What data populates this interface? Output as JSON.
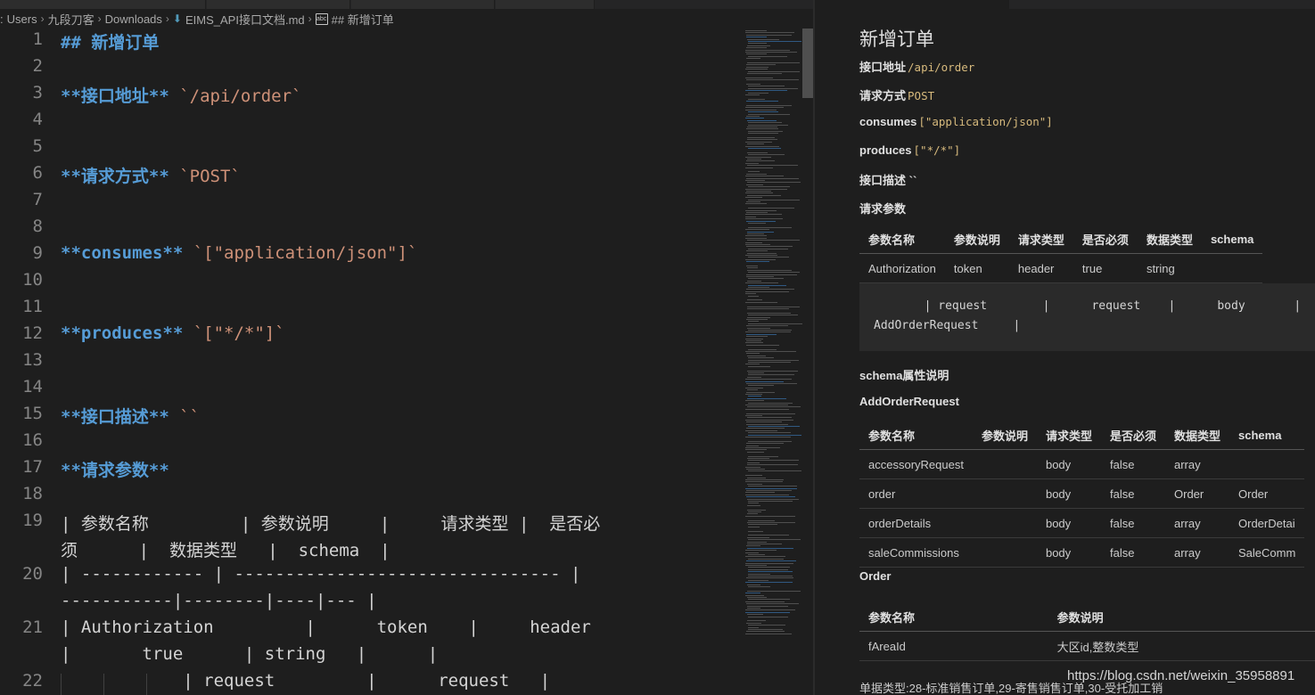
{
  "breadcrumb": {
    "items": [
      ":",
      "Users",
      "九段刀客",
      "Downloads",
      "EIMS_API接口文档.md",
      "## 新增订单"
    ],
    "download_icon": "download-file-icon",
    "symbol_icon": "abc-symbol-icon"
  },
  "editor": {
    "lines": [
      {
        "n": "1",
        "parts": [
          {
            "t": "## 新增订单",
            "c": "hdr"
          }
        ]
      },
      {
        "n": "2",
        "parts": []
      },
      {
        "n": "3",
        "parts": [
          {
            "t": "**接口地址**",
            "c": "bold"
          },
          {
            "t": " `/api/order`",
            "c": "str"
          }
        ]
      },
      {
        "n": "4",
        "parts": []
      },
      {
        "n": "5",
        "parts": []
      },
      {
        "n": "6",
        "parts": [
          {
            "t": "**请求方式**",
            "c": "bold"
          },
          {
            "t": " `POST`",
            "c": "str"
          }
        ]
      },
      {
        "n": "7",
        "parts": []
      },
      {
        "n": "8",
        "parts": []
      },
      {
        "n": "9",
        "parts": [
          {
            "t": "**consumes**",
            "c": "bold"
          },
          {
            "t": " `[\"application/json\"]`",
            "c": "str"
          }
        ]
      },
      {
        "n": "10",
        "parts": []
      },
      {
        "n": "11",
        "parts": []
      },
      {
        "n": "12",
        "parts": [
          {
            "t": "**produces**",
            "c": "bold"
          },
          {
            "t": " `[\"*/*\"]`",
            "c": "str"
          }
        ]
      },
      {
        "n": "13",
        "parts": []
      },
      {
        "n": "14",
        "parts": []
      },
      {
        "n": "15",
        "parts": [
          {
            "t": "**接口描述**",
            "c": "bold"
          },
          {
            "t": " ``",
            "c": "str"
          }
        ]
      },
      {
        "n": "16",
        "parts": []
      },
      {
        "n": "17",
        "parts": [
          {
            "t": "**请求参数**",
            "c": "bold"
          }
        ]
      },
      {
        "n": "18",
        "parts": []
      },
      {
        "n": "19",
        "parts": [
          {
            "t": "| 参数名称         | 参数说明     |     请求类型 |  是否必",
            "c": "plain"
          }
        ]
      },
      {
        "n": "",
        "parts": [
          {
            "t": "须      |  数据类型   |  schema  |",
            "c": "plain"
          }
        ]
      },
      {
        "n": "20",
        "parts": [
          {
            "t": "| ------------ | -------------------------------- |",
            "c": "plain"
          }
        ]
      },
      {
        "n": "",
        "parts": [
          {
            "t": "-----------|--------|----|--- |",
            "c": "plain"
          }
        ]
      },
      {
        "n": "21",
        "parts": [
          {
            "t": "| Authorization         |      token    |     header",
            "c": "plain"
          }
        ]
      },
      {
        "n": "",
        "parts": [
          {
            "t": "|       true      | string   |      |",
            "c": "plain"
          }
        ]
      },
      {
        "n": "22",
        "parts": [
          {
            "t": "            | request         |      request   |",
            "c": "plain"
          }
        ]
      }
    ]
  },
  "preview": {
    "title": "新增订单",
    "api_address_label": "接口地址",
    "api_address_value": "/api/order",
    "method_label": "请求方式",
    "method_value": "POST",
    "consumes_label": "consumes",
    "consumes_value": "[\"application/json\"]",
    "produces_label": "produces",
    "produces_value": "[\"*/*\"]",
    "description_label": "接口描述 ``",
    "request_params_label": "请求参数",
    "params_table": {
      "headers": [
        "参数名称",
        "参数说明",
        "请求类型",
        "是否必须",
        "数据类型",
        "schema"
      ],
      "rows": [
        [
          "Authorization",
          "token",
          "header",
          "true",
          "string",
          ""
        ]
      ]
    },
    "code_block": {
      "line1": "        | request        |      request    |      body       |",
      "line2": "AddOrderRequest     |"
    },
    "schema_desc_label": "schema属性说明",
    "schema_name": "AddOrderRequest",
    "schema_table": {
      "headers": [
        "参数名称",
        "参数说明",
        "请求类型",
        "是否必须",
        "数据类型",
        "schema"
      ],
      "rows": [
        [
          "accessoryRequest",
          "",
          "body",
          "false",
          "array",
          ""
        ],
        [
          "order",
          "",
          "body",
          "false",
          "Order",
          "Order"
        ],
        [
          "orderDetails",
          "",
          "body",
          "false",
          "array",
          "OrderDetai"
        ],
        [
          "saleCommissions",
          "",
          "body",
          "false",
          "array",
          "SaleComm"
        ]
      ]
    },
    "order_label": "Order",
    "order_table": {
      "headers": [
        "参数名称",
        "参数说明"
      ],
      "rows": [
        [
          "fAreaId",
          "大区id,整数类型"
        ]
      ]
    },
    "footer_partial": "单据类型:28-标准销售订单,29-寄售销售订单,30-受托加工销"
  },
  "watermark": "https://blog.csdn.net/weixin_35958891"
}
